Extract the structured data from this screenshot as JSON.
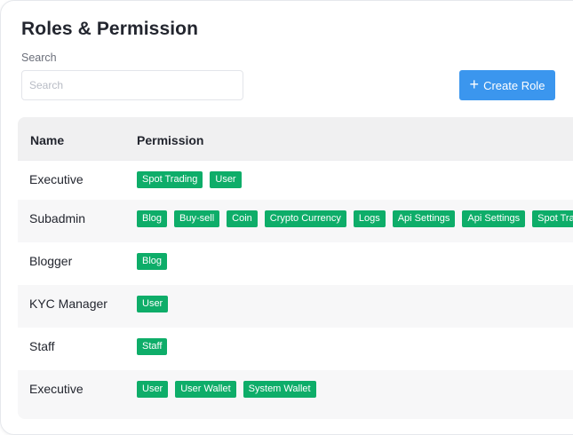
{
  "page": {
    "title": "Roles & Permission"
  },
  "search": {
    "label": "Search",
    "placeholder": "Search",
    "value": ""
  },
  "toolbar": {
    "create_label": "Create Role",
    "accent": "#3b96ee"
  },
  "table": {
    "headers": {
      "name": "Name",
      "permission": "Permission"
    },
    "chip_color": "#0ead69",
    "rows": [
      {
        "name": "Executive",
        "permissions": [
          "Spot Trading",
          "User"
        ]
      },
      {
        "name": "Subadmin",
        "permissions": [
          "Blog",
          "Buy-sell",
          "Coin",
          "Crypto Currency",
          "Logs",
          "Api Settings",
          "Api Settings",
          "Spot Trading"
        ]
      },
      {
        "name": "Blogger",
        "permissions": [
          "Blog"
        ]
      },
      {
        "name": "KYC Manager",
        "permissions": [
          "User"
        ]
      },
      {
        "name": "Staff",
        "permissions": [
          "Staff"
        ]
      },
      {
        "name": "Executive",
        "permissions": [
          "User",
          "User Wallet",
          "System Wallet"
        ]
      }
    ]
  }
}
